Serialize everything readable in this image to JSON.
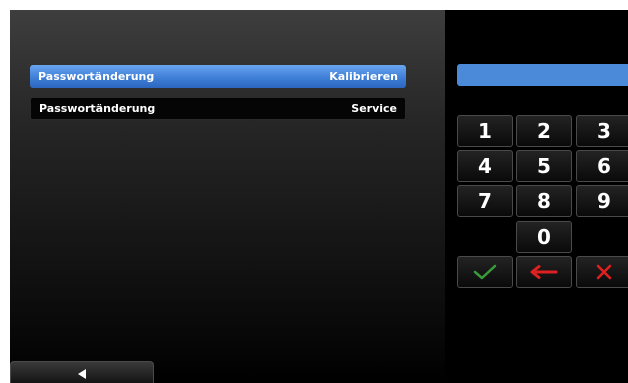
{
  "menu": {
    "rows": [
      {
        "left": "Passwortänderung",
        "right": "Kalibrieren",
        "selected": true
      },
      {
        "left": "Passwortänderung",
        "right": "Service",
        "selected": false
      }
    ]
  },
  "entry": {
    "value": ""
  },
  "keypad": {
    "digits": [
      "1",
      "2",
      "3",
      "4",
      "5",
      "6",
      "7",
      "8",
      "9",
      "0"
    ],
    "actions": [
      {
        "icon": "checkmark-icon",
        "color": "#3a9a3a"
      },
      {
        "icon": "arrow-left-icon",
        "color": "#e02020"
      },
      {
        "icon": "x-icon",
        "color": "#e02020"
      }
    ]
  },
  "colors": {
    "accent": "#3f7fd7",
    "ok": "#3a9a3a",
    "cancel": "#e02020"
  }
}
